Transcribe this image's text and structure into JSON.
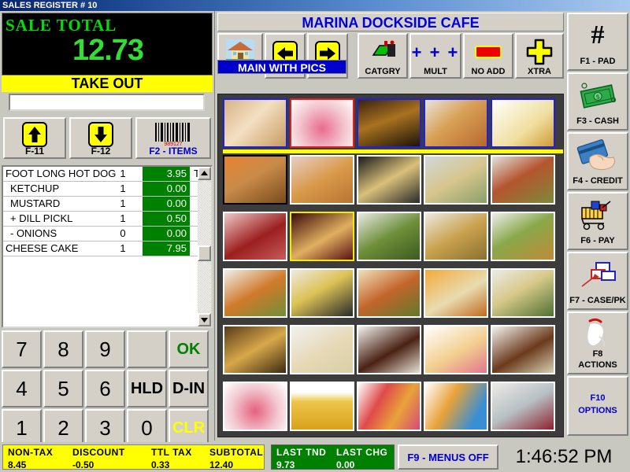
{
  "window": {
    "title": "SALES REGISTER # 10"
  },
  "sale": {
    "total_label": "SALE TOTAL",
    "total_value": "12.73",
    "order_type": "TAKE OUT",
    "entry_value": ""
  },
  "left_buttons": [
    {
      "name": "f11",
      "label": "F-11",
      "icon": "arrow-up-icon"
    },
    {
      "name": "f12",
      "label": "F-12",
      "icon": "arrow-down-icon"
    },
    {
      "name": "f2-items",
      "label": "F2 - ITEMS",
      "icon": "barcode-icon"
    }
  ],
  "order_items": [
    {
      "desc": "FOOT LONG HOT DOG",
      "qty": "1",
      "amount": "3.95",
      "tax": "T",
      "indent": false
    },
    {
      "desc": "KETCHUP",
      "qty": "1",
      "amount": "0.00",
      "tax": "",
      "indent": true
    },
    {
      "desc": "MUSTARD",
      "qty": "1",
      "amount": "0.00",
      "tax": "",
      "indent": true
    },
    {
      "desc": "+ DILL PICKL",
      "qty": "1",
      "amount": "0.50",
      "tax": "",
      "indent": true
    },
    {
      "desc": "- ONIONS",
      "qty": "0",
      "amount": "0.00",
      "tax": "",
      "indent": true
    },
    {
      "desc": "CHEESE CAKE",
      "qty": "1",
      "amount": "7.95",
      "tax": "",
      "indent": false
    }
  ],
  "keypad": [
    {
      "key": "7",
      "style": "num"
    },
    {
      "key": "8",
      "style": "num"
    },
    {
      "key": "9",
      "style": "num"
    },
    {
      "key": "",
      "style": "blank"
    },
    {
      "key": "OK",
      "style": "ok"
    },
    {
      "key": "4",
      "style": "num"
    },
    {
      "key": "5",
      "style": "num"
    },
    {
      "key": "6",
      "style": "num"
    },
    {
      "key": "HLD",
      "style": "small"
    },
    {
      "key": "D-IN",
      "style": "small"
    },
    {
      "key": "1",
      "style": "num"
    },
    {
      "key": "2",
      "style": "num"
    },
    {
      "key": "3",
      "style": "num"
    },
    {
      "key": "0",
      "style": "num"
    },
    {
      "key": "CLR",
      "style": "clr"
    }
  ],
  "menu": {
    "store_title": "MARINA DOCKSIDE CAFE",
    "current_menu": "MAIN WITH PICS",
    "toolbar": [
      {
        "name": "home",
        "label": "",
        "icon": "house-icon"
      },
      {
        "name": "prev",
        "label": "",
        "icon": "arrow-left-icon"
      },
      {
        "name": "next",
        "label": "",
        "icon": "arrow-right-icon"
      },
      {
        "name": "catgry",
        "label": "CATGRY",
        "icon": "category-icon"
      },
      {
        "name": "mult",
        "label": "MULT",
        "icon": "plus-plus-plus-icon"
      },
      {
        "name": "no-add",
        "label": "NO ADD",
        "icon": "minus-bar-icon"
      },
      {
        "name": "xtra",
        "label": "XTRA",
        "icon": "plus-cross-icon"
      }
    ],
    "grid_rows": [
      {
        "divider_after": true,
        "cells": [
          {
            "item": "cutlery",
            "border": "sel-blue"
          },
          {
            "item": "ice-cream",
            "border": "sel-red"
          },
          {
            "item": "wine-bottle",
            "border": "sel-blue"
          },
          {
            "item": "club-sandwich",
            "border": "sel-blue"
          },
          {
            "item": "condiment",
            "border": "sel-blue"
          }
        ]
      },
      {
        "divider_after": false,
        "cells": [
          {
            "item": "chili-dog",
            "border": "sel-black"
          },
          {
            "item": "corn-dog",
            "border": ""
          },
          {
            "item": "slaw-dog",
            "border": ""
          },
          {
            "item": "relish-dog",
            "border": ""
          },
          {
            "item": "tomato-sub",
            "border": ""
          }
        ]
      },
      {
        "divider_after": false,
        "cells": [
          {
            "item": "chili-cheese-dog",
            "border": ""
          },
          {
            "item": "french-fries",
            "border": "sel-yellow"
          },
          {
            "item": "veggie-platter",
            "border": ""
          },
          {
            "item": "egg-rolls",
            "border": ""
          },
          {
            "item": "sampler-plate",
            "border": ""
          }
        ]
      },
      {
        "divider_after": false,
        "cells": [
          {
            "item": "shrimp-salad",
            "border": ""
          },
          {
            "item": "fish-tacos",
            "border": ""
          },
          {
            "item": "taco-salad",
            "border": ""
          },
          {
            "item": "chicken-slaw",
            "border": ""
          },
          {
            "item": "caesar-salad",
            "border": ""
          }
        ]
      },
      {
        "divider_after": false,
        "cells": [
          {
            "item": "nachos",
            "border": ""
          },
          {
            "item": "cheese-cake",
            "border": ""
          },
          {
            "item": "chocolate-cake",
            "border": ""
          },
          {
            "item": "fruit-parfait",
            "border": ""
          },
          {
            "item": "chocolate-pie",
            "border": ""
          }
        ]
      },
      {
        "divider_after": false,
        "cells": [
          {
            "item": "ice-cream-sundae",
            "border": ""
          },
          {
            "item": "draft-beer",
            "border": ""
          },
          {
            "item": "smoothies",
            "border": ""
          },
          {
            "item": "cocktails",
            "border": ""
          },
          {
            "item": "wine-glasses",
            "border": ""
          }
        ]
      }
    ]
  },
  "sidebar": [
    {
      "name": "f1-pad",
      "lines": [
        "F1 - PAD"
      ],
      "icon": "hash-icon",
      "blue": false
    },
    {
      "name": "f3-cash",
      "lines": [
        "F3 - CASH"
      ],
      "icon": "cash-icon",
      "blue": false
    },
    {
      "name": "f4-credit",
      "lines": [
        "F4 - CREDIT"
      ],
      "icon": "credit-card-icon",
      "blue": false
    },
    {
      "name": "f6-pay",
      "lines": [
        "F6 - PAY"
      ],
      "icon": "cart-icon",
      "blue": false
    },
    {
      "name": "f7-case-pk",
      "lines": [
        "F7 - CASE/PK"
      ],
      "icon": "boxes-icon",
      "blue": false
    },
    {
      "name": "f8-actions",
      "lines": [
        "F8",
        "ACTIONS"
      ],
      "icon": "hand-icon",
      "blue": false
    },
    {
      "name": "f10-options",
      "lines": [
        "F10",
        "OPTIONS"
      ],
      "icon": "",
      "blue": true
    }
  ],
  "status": {
    "totals": [
      {
        "head": "NON-TAX",
        "value": "8.45"
      },
      {
        "head": "DISCOUNT",
        "value": "-0.50"
      },
      {
        "head": "TTL TAX",
        "value": "0.33"
      },
      {
        "head": "SUBTOTAL",
        "value": "12.40"
      }
    ],
    "last": [
      {
        "head": "LAST TND",
        "value": "9.73"
      },
      {
        "head": "LAST CHG",
        "value": "0.00"
      }
    ],
    "menus_button": "F9 - MENUS OFF",
    "clock": "1:46:52 PM"
  },
  "colors": {
    "accent_blue": "#0000cc",
    "yellow": "#ffff00",
    "green": "#008000",
    "lcd_green": "#33dd33",
    "face": "#d4d0c8"
  }
}
